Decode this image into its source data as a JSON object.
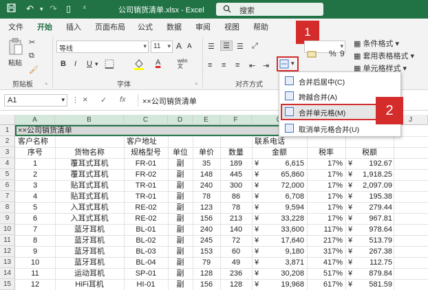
{
  "titlebar": {
    "filename": "公司销货清单.xlsx  -  Excel",
    "search": "搜索",
    "bg_color": "#217346"
  },
  "menu": {
    "tabs": [
      "文件",
      "开始",
      "插入",
      "页面布局",
      "公式",
      "数据",
      "审阅",
      "视图",
      "帮助"
    ],
    "active": "开始"
  },
  "ribbon": {
    "clipboard": {
      "paste": "粘贴",
      "label": "剪贴板"
    },
    "font": {
      "name": "等线",
      "size": "11",
      "label": "字体",
      "grow": "A",
      "shrink": "A",
      "bold": "B",
      "italic": "I",
      "underline": "U",
      "fontcolor": "A",
      "wen": "wén"
    },
    "align": {
      "label": "对齐方式"
    },
    "number": {
      "percent": "%",
      "comma": "9"
    },
    "styles": {
      "cond": "条件格式",
      "table": "套用表格格式",
      "cell": "单元格样式",
      "label": "样式"
    },
    "marker1": "1",
    "marker2": "2"
  },
  "merge_menu": {
    "items": [
      "合并后居中(C)",
      "跨越合并(A)",
      "合并单元格(M)",
      "取消单元格合并(U)"
    ],
    "selected_index": 2
  },
  "formula_bar": {
    "cell_ref": "A1",
    "cancel": "×",
    "enter": "✓",
    "fx": "fx",
    "content": "××公司销货清单"
  },
  "sheet": {
    "columns": [
      "A",
      "B",
      "C",
      "D",
      "E",
      "F",
      "G",
      "H",
      "I",
      "J"
    ],
    "row1": "××公司销货清单",
    "row2": {
      "a": "客户名称",
      "c": "客户地址",
      "g": "联系电话"
    },
    "headers": [
      "序号",
      "货物名称",
      "规格型号",
      "单位",
      "单价",
      "数量",
      "金额",
      "税率",
      "税额"
    ],
    "currency": "¥",
    "rows": [
      [
        "1",
        "覆耳式耳机",
        "FR-01",
        "副",
        "35",
        "189",
        "6,615",
        "17%",
        "192.67"
      ],
      [
        "2",
        "覆耳式耳机",
        "FR-02",
        "副",
        "148",
        "445",
        "65,860",
        "17%",
        "1,918.25"
      ],
      [
        "3",
        "贴耳式耳机",
        "TR-01",
        "副",
        "240",
        "300",
        "72,000",
        "17%",
        "2,097.09"
      ],
      [
        "4",
        "贴耳式耳机",
        "TR-01",
        "副",
        "78",
        "86",
        "6,708",
        "17%",
        "195.38"
      ],
      [
        "5",
        "入耳式耳机",
        "RE-02",
        "副",
        "123",
        "78",
        "9,594",
        "17%",
        "279.44"
      ],
      [
        "6",
        "入耳式耳机",
        "RE-02",
        "副",
        "156",
        "213",
        "33,228",
        "17%",
        "967.81"
      ],
      [
        "7",
        "蓝牙耳机",
        "BL-01",
        "副",
        "240",
        "140",
        "33,600",
        "117%",
        "978.64"
      ],
      [
        "8",
        "蓝牙耳机",
        "BL-02",
        "副",
        "245",
        "72",
        "17,640",
        "217%",
        "513.79"
      ],
      [
        "9",
        "蓝牙耳机",
        "BL-03",
        "副",
        "153",
        "60",
        "9,180",
        "317%",
        "267.38"
      ],
      [
        "10",
        "蓝牙耳机",
        "BL-04",
        "副",
        "79",
        "49",
        "3,871",
        "417%",
        "112.75"
      ],
      [
        "11",
        "运动耳机",
        "SP-01",
        "副",
        "128",
        "236",
        "30,208",
        "517%",
        "879.84"
      ],
      [
        "12",
        "HiFi耳机",
        "HI-01",
        "副",
        "156",
        "128",
        "19,968",
        "617%",
        "581.59"
      ]
    ],
    "row_numbers": [
      "1",
      "2",
      "3",
      "4",
      "5",
      "6",
      "7",
      "8",
      "9",
      "10",
      "11",
      "12",
      "13",
      "14",
      "15"
    ]
  },
  "colors": {
    "accent": "#217346",
    "highlight": "#d42b2b"
  }
}
